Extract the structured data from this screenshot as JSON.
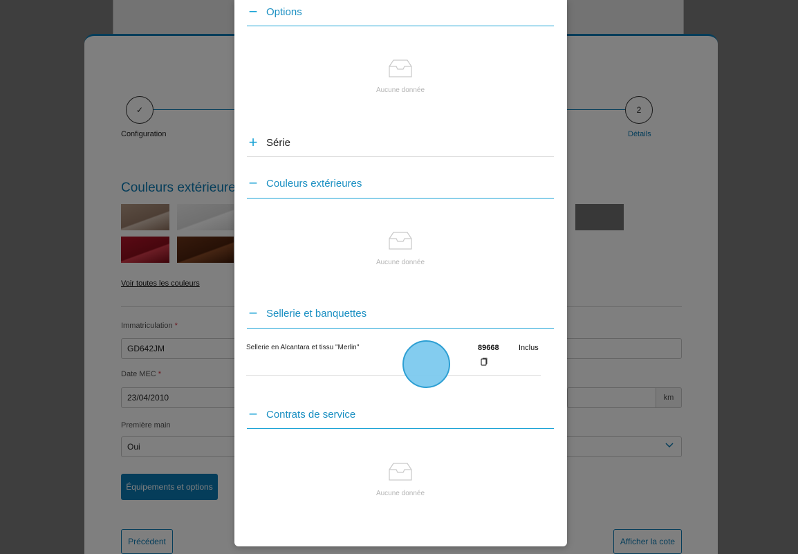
{
  "stepper": {
    "steps": [
      {
        "label": "Configuration",
        "symbol": "✓"
      },
      {
        "label": "Détails",
        "symbol": "2"
      }
    ]
  },
  "exterior": {
    "title": "Couleurs extérieures",
    "link": "Voir toutes les couleurs",
    "swatch_colors": [
      "#a58a77",
      "#ececec",
      "#a11222",
      "#5a2a14",
      "#6f6f6f"
    ]
  },
  "form": {
    "registration": {
      "label": "Immatriculation",
      "value": "GD642JM"
    },
    "date_mec": {
      "label": "Date MEC",
      "value": "23/04/2010"
    },
    "mileage_unit": "km",
    "first_owner": {
      "label": "Première main",
      "value": "Oui"
    },
    "required_mark": "*"
  },
  "buttons": {
    "equipment": "Équipements et options",
    "previous": "Précédent",
    "show_quote": "Afficher la cote"
  },
  "modal": {
    "empty_text": "Aucune donnée",
    "sections": {
      "options": {
        "sign": "−",
        "title": "Options"
      },
      "serie": {
        "sign": "+",
        "title": "Série"
      },
      "colors": {
        "sign": "−",
        "title": "Couleurs extérieures"
      },
      "upholstery": {
        "sign": "−",
        "title": "Sellerie et banquettes"
      },
      "contracts": {
        "sign": "−",
        "title": "Contrats de service"
      }
    },
    "upholstery_row": {
      "name": "Sellerie en Alcantara et tissu \"Merlin\"",
      "code": "89668",
      "status": "Inclus"
    }
  }
}
